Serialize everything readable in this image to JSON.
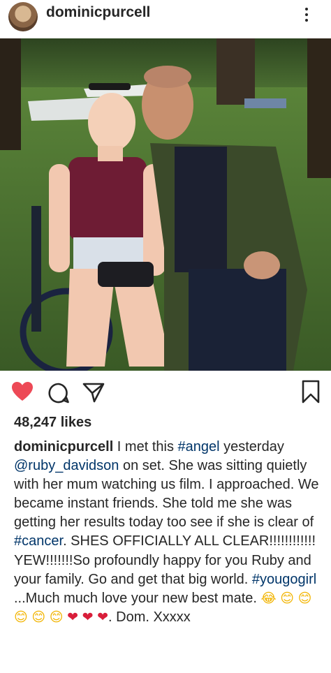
{
  "header": {
    "username": "dominicpurcell",
    "more_icon": "more-options-icon"
  },
  "post": {
    "likes_text": "48,247 likes",
    "caption": {
      "username": "dominicpurcell",
      "t1": " I met this ",
      "tag_angel": "#angel",
      "t2": " yesterday ",
      "mention": "@ruby_davidson",
      "t3": " on set. She was sitting quietly with her mum watching us film. I approached. We became instant friends. She told me she was getting her results today too see if she is clear of ",
      "tag_cancer": "#cancer",
      "t4": ". SHES OFFICIALLY ALL CLEAR!!!!!!!!!!!! YEW!!!!!!!So profoundly happy for you Ruby and your family. Go and get that big world.  ",
      "tag_yougogirl": "#yougogirl",
      "t5": " ...Much much love your new best mate. ",
      "emoji_1": "😂",
      "emoji_2": "😊",
      "emoji_3": "😊",
      "emoji_4": "😊",
      "emoji_5": "😊",
      "emoji_6": "😊",
      "emoji_7": "❤",
      "emoji_8": "❤",
      "emoji_9": "❤",
      "t6": ". Dom. Xxxxx"
    }
  },
  "icons": {
    "like": "heart-icon",
    "comment": "comment-icon",
    "share": "share-icon",
    "save": "bookmark-icon"
  },
  "colors": {
    "like_red": "#ed4956",
    "text": "#262626",
    "link": "#003569"
  }
}
